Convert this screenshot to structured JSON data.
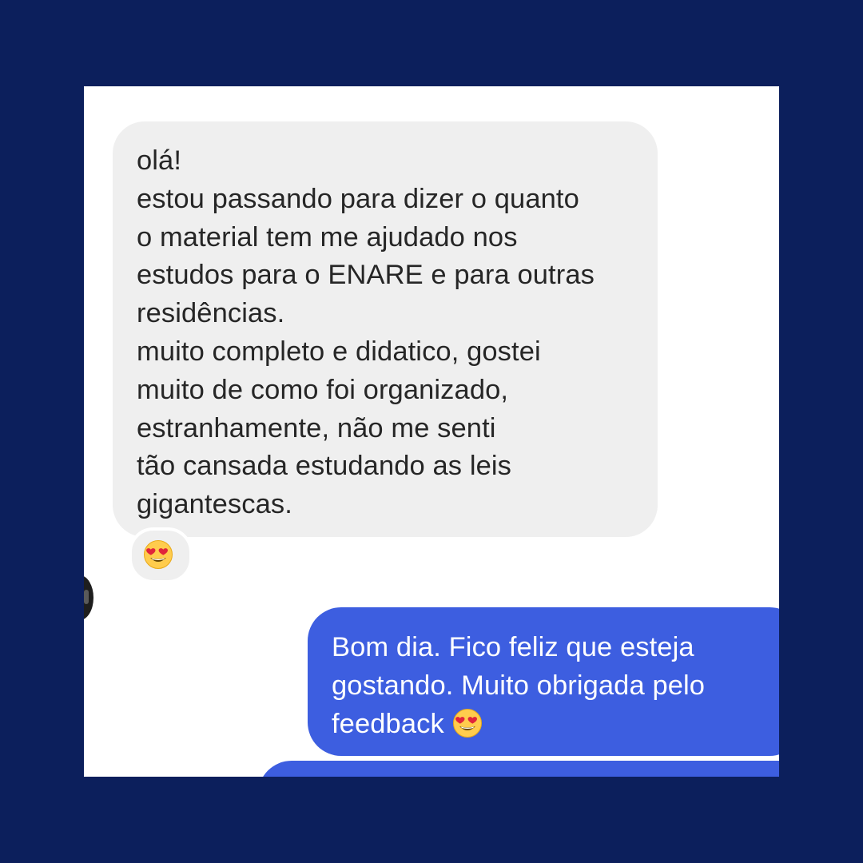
{
  "conversation": {
    "received_message": {
      "lines": [
        "olá!",
        "estou passando para dizer o quanto",
        "o material tem me ajudado nos",
        "estudos para o ENARE e para outras",
        "residências.",
        "muito completo e didatico, gostei",
        "muito de como foi organizado,",
        "estranhamente, não me senti",
        "tão cansada estudando as leis",
        "gigantescas."
      ],
      "reaction_icon": "heart-eyes-emoji"
    },
    "sent_message": {
      "lines": [
        "Bom dia. Fico feliz que esteja",
        "gostando. Muito obrigada pelo",
        "feedback"
      ],
      "trailing_icon": "heart-eyes-emoji"
    }
  },
  "colors": {
    "page_background": "#0c1f5c",
    "received_bubble": "#efefef",
    "sent_bubble": "#3d5ee0",
    "received_text": "#262626",
    "sent_text": "#ffffff"
  }
}
